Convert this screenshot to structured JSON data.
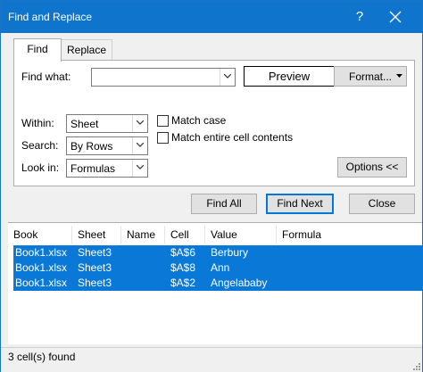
{
  "window": {
    "title": "Find and Replace",
    "help_label": "?"
  },
  "tabs": [
    {
      "label": "Find",
      "active": true
    },
    {
      "label": "Replace",
      "active": false
    }
  ],
  "find": {
    "find_what_label": "Find what:",
    "find_what_value": "",
    "preview_label": "Preview",
    "format_label": "Format...",
    "within_label": "Within:",
    "within_value": "Sheet",
    "search_label": "Search:",
    "search_value": "By Rows",
    "lookin_label": "Look in:",
    "lookin_value": "Formulas",
    "match_case_label": "Match case",
    "match_case_checked": false,
    "match_entire_label": "Match entire cell contents",
    "match_entire_checked": false,
    "options_label": "Options <<"
  },
  "buttons": {
    "find_all": "Find All",
    "find_next": "Find Next",
    "close": "Close"
  },
  "results": {
    "columns": [
      "Book",
      "Sheet",
      "Name",
      "Cell",
      "Value",
      "Formula"
    ],
    "rows": [
      {
        "book": "Book1.xlsx",
        "sheet": "Sheet3",
        "name": "",
        "cell": "$A$6",
        "value": "Berbury",
        "formula": ""
      },
      {
        "book": "Book1.xlsx",
        "sheet": "Sheet3",
        "name": "",
        "cell": "$A$8",
        "value": "Ann",
        "formula": ""
      },
      {
        "book": "Book1.xlsx",
        "sheet": "Sheet3",
        "name": "",
        "cell": "$A$2",
        "value": "Angelababy",
        "formula": ""
      }
    ]
  },
  "status": {
    "text": "3 cell(s) found"
  },
  "colors": {
    "titlebar": "#0f74cc",
    "selection": "#0a78d7",
    "focus_border": "#0078d7"
  }
}
